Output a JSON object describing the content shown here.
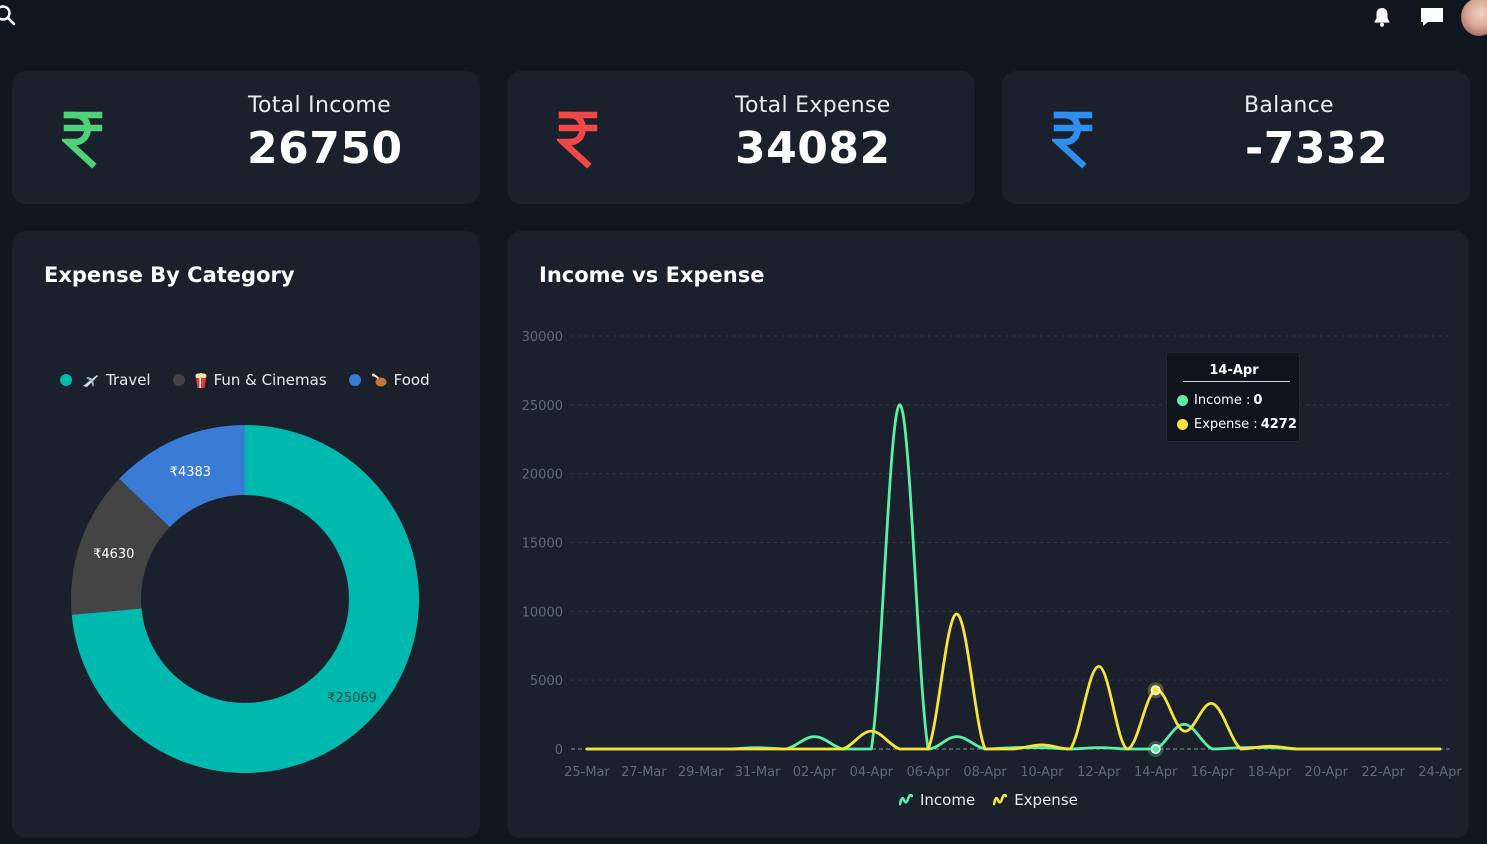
{
  "colors": {
    "income_green": "#4fd17a",
    "expense_red": "#f04848",
    "balance_blue": "#2f8ef0",
    "travel": "#00b9ae",
    "fun": "#444444",
    "food": "#3a7bd5",
    "line_income": "#5cf0a2",
    "line_expense": "#f7e43a"
  },
  "header": {
    "icons": [
      "search-icon",
      "bell-icon",
      "chat-icon"
    ]
  },
  "stats": {
    "income": {
      "label": "Total Income",
      "value": "26750",
      "icon": "rupee-icon"
    },
    "expense": {
      "label": "Total Expense",
      "value": "34082",
      "icon": "rupee-icon"
    },
    "balance": {
      "label": "Balance",
      "value": "-7332",
      "icon": "rupee-icon"
    }
  },
  "category_panel": {
    "title": "Expense By Category",
    "legend": [
      {
        "label": "Travel",
        "icon": "airplane-icon"
      },
      {
        "label": "Fun & Cinemas",
        "icon": "popcorn-icon"
      },
      {
        "label": "Food",
        "icon": "drumstick-icon"
      }
    ]
  },
  "trend_panel": {
    "title": "Income vs Expense",
    "tooltip": {
      "date": "14-Apr",
      "income_label": "Income :",
      "income_value": "0",
      "expense_label": "Expense :",
      "expense_value": "4272"
    },
    "legend": [
      "Income",
      "Expense"
    ]
  },
  "chart_data": [
    {
      "type": "pie",
      "title": "Expense By Category",
      "categories": [
        "Travel",
        "Fun & Cinemas",
        "Food"
      ],
      "values": [
        25069,
        4630,
        4383
      ],
      "data_labels": [
        "₹25069",
        "₹4630",
        "₹4383"
      ],
      "donut": true,
      "legend_position": "top"
    },
    {
      "type": "line",
      "title": "Income vs Expense",
      "x": [
        "25-Mar",
        "26-Mar",
        "27-Mar",
        "28-Mar",
        "29-Mar",
        "30-Mar",
        "31-Mar",
        "01-Apr",
        "02-Apr",
        "03-Apr",
        "04-Apr",
        "05-Apr",
        "06-Apr",
        "07-Apr",
        "08-Apr",
        "09-Apr",
        "10-Apr",
        "11-Apr",
        "12-Apr",
        "13-Apr",
        "14-Apr",
        "15-Apr",
        "16-Apr",
        "17-Apr",
        "18-Apr",
        "19-Apr",
        "20-Apr",
        "21-Apr",
        "22-Apr",
        "23-Apr",
        "24-Apr"
      ],
      "x_tick_labels": [
        "25-Mar",
        "27-Mar",
        "29-Mar",
        "31-Mar",
        "02-Apr",
        "04-Apr",
        "06-Apr",
        "08-Apr",
        "10-Apr",
        "12-Apr",
        "14-Apr",
        "16-Apr",
        "18-Apr",
        "20-Apr",
        "22-Apr",
        "24-Apr"
      ],
      "series": [
        {
          "name": "Income",
          "values": [
            0,
            0,
            0,
            0,
            0,
            0,
            100,
            0,
            900,
            0,
            0,
            25000,
            0,
            900,
            0,
            100,
            100,
            0,
            100,
            0,
            0,
            1800,
            0,
            100,
            100,
            0,
            0,
            0,
            0,
            0,
            0
          ]
        },
        {
          "name": "Expense",
          "values": [
            0,
            0,
            0,
            0,
            0,
            0,
            0,
            0,
            0,
            0,
            1300,
            0,
            0,
            9800,
            0,
            0,
            300,
            0,
            6000,
            0,
            4272,
            1300,
            3300,
            0,
            200,
            0,
            0,
            0,
            0,
            0,
            0
          ]
        }
      ],
      "y_ticks": [
        0,
        5000,
        10000,
        15000,
        20000,
        25000,
        30000
      ],
      "ylim": [
        0,
        30000
      ],
      "grid": true,
      "legend_position": "bottom"
    }
  ]
}
